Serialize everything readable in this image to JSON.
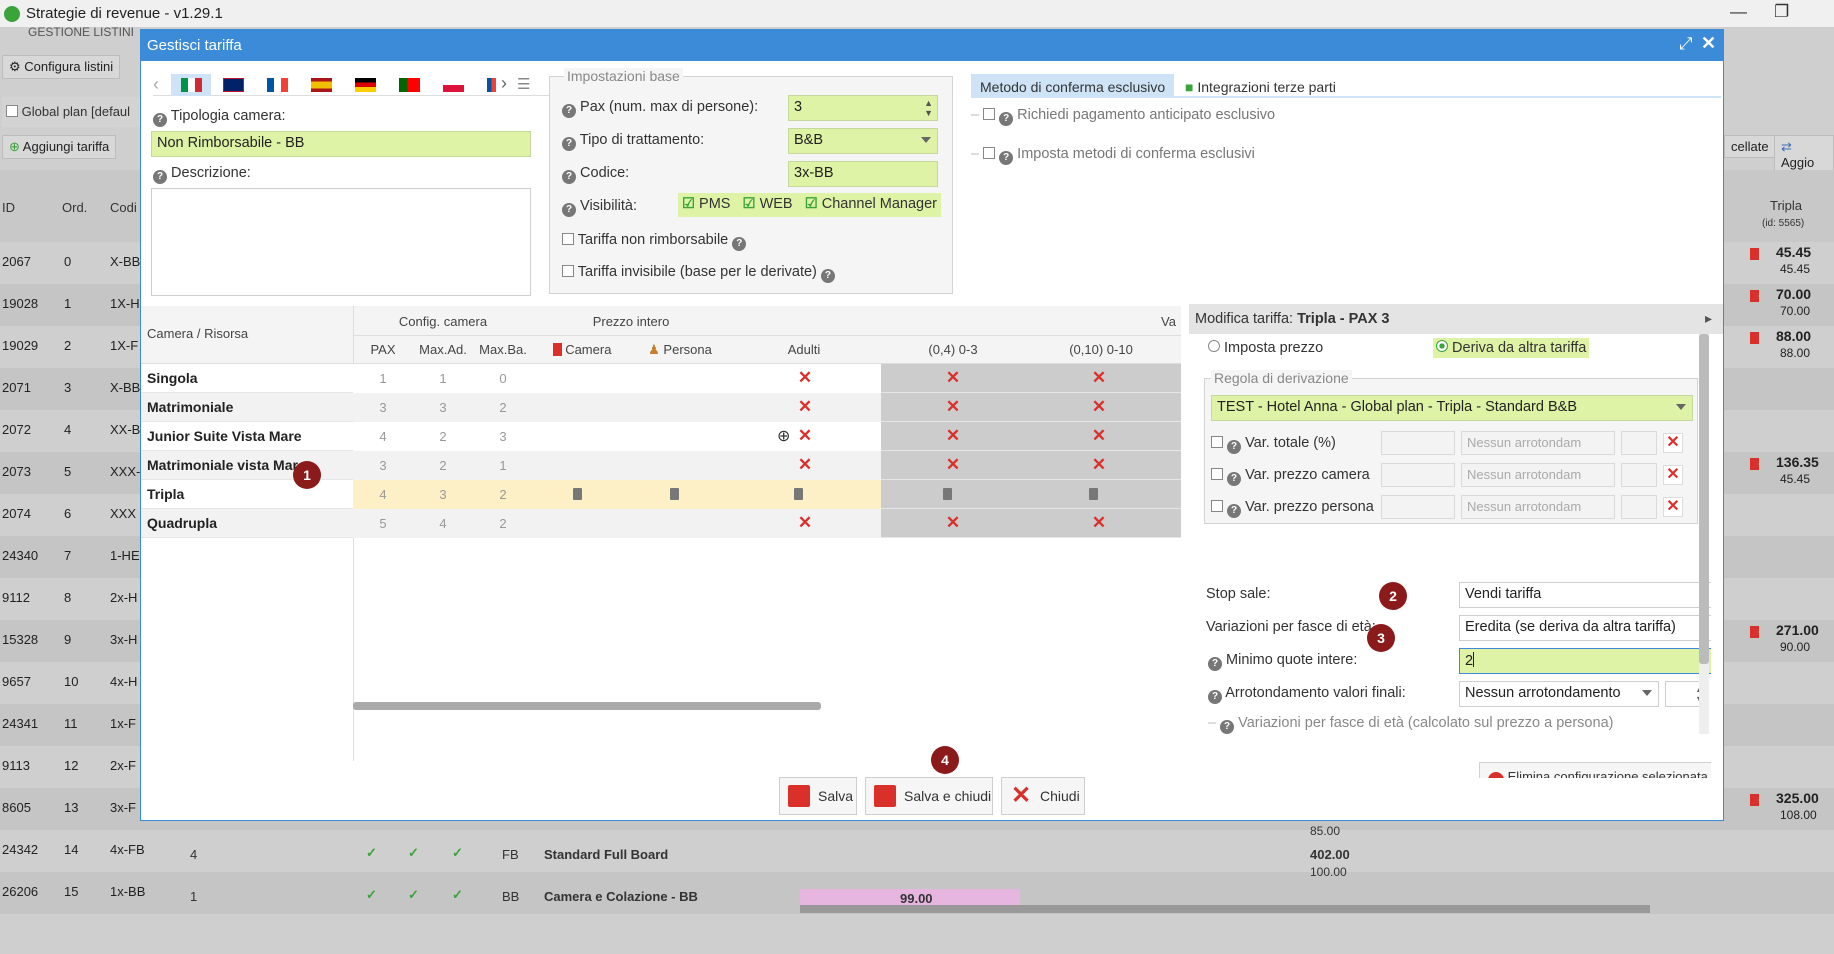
{
  "window": {
    "title": "Strategie di revenue - v1.29.1",
    "minimize": "—",
    "restore": "❐"
  },
  "background": {
    "header_crumb": "GESTIONE LISTINI",
    "configura_btn": "Configura listini",
    "global_plan": "Global plan [defaul",
    "aggiungi_btn": "Aggiungi tariffa",
    "annullate_btn": "cellate",
    "aggiorna_btn": "Aggio",
    "columns": {
      "id": "ID",
      "ord": "Ord.",
      "cod": "Codi",
      "tripla": "Tripla",
      "tripla_id": "(id: 5565)"
    },
    "rows": [
      {
        "id": "2067",
        "ord": "0",
        "cod": "X-BB",
        "p1": "45.45",
        "p2": "45.45"
      },
      {
        "id": "19028",
        "ord": "1",
        "cod": "1X-H",
        "p1": "70.00",
        "p2": "70.00"
      },
      {
        "id": "19029",
        "ord": "2",
        "cod": "1X-F",
        "p1": "88.00",
        "p2": "88.00"
      },
      {
        "id": "2071",
        "ord": "3",
        "cod": "X-BB",
        "p1": "",
        "p2": ""
      },
      {
        "id": "2072",
        "ord": "4",
        "cod": "XX-B",
        "p1": "",
        "p2": ""
      },
      {
        "id": "2073",
        "ord": "5",
        "cod": "XXX-",
        "p1": "136.35",
        "p2": "45.45"
      },
      {
        "id": "2074",
        "ord": "6",
        "cod": "XXX",
        "p1": "",
        "p2": ""
      },
      {
        "id": "24340",
        "ord": "7",
        "cod": "1-HE",
        "p1": "",
        "p2": ""
      },
      {
        "id": "9112",
        "ord": "8",
        "cod": "2x-H",
        "p1": "",
        "p2": ""
      },
      {
        "id": "15328",
        "ord": "9",
        "cod": "3x-H",
        "p1": "271.00",
        "p2": "90.00"
      },
      {
        "id": "9657",
        "ord": "10",
        "cod": "4x-H",
        "p1": "",
        "p2": ""
      },
      {
        "id": "24341",
        "ord": "11",
        "cod": "1x-F",
        "p1": "",
        "p2": ""
      },
      {
        "id": "9113",
        "ord": "12",
        "cod": "2x-F",
        "p1": "",
        "p2": ""
      },
      {
        "id": "8605",
        "ord": "13",
        "cod": "3x-F",
        "p1": "325.00",
        "p2": "108.00"
      },
      {
        "id": "24342",
        "ord": "14",
        "cod": "4x-FB",
        "p1": "",
        "p2": ""
      },
      {
        "id": "26206",
        "ord": "15",
        "cod": "1x-BB",
        "p1": "",
        "p2": ""
      }
    ],
    "row14": {
      "pax": "4",
      "treat": "FB",
      "name": "Standard Full Board",
      "v1": "85.00",
      "v2": "402.00",
      "v3": "100.00"
    },
    "row15": {
      "pax": "1",
      "treat": "BB",
      "name": "Camera e Colazione - BB",
      "v1": "99.00"
    }
  },
  "dialog": {
    "title": "Gestisci tariffa",
    "tipologia_label": "Tipologia camera:",
    "tipologia_value": "Non Rimborsabile - BB",
    "descrizione_label": "Descrizione:",
    "impostazioni_legend": "Impostazioni base",
    "pax_label": "Pax (num. max di persone):",
    "pax_value": "3",
    "trattamento_label": "Tipo di trattamento:",
    "trattamento_value": "B&B",
    "codice_label": "Codice:",
    "codice_value": "3x-BB",
    "visibilita_label": "Visibilità:",
    "vis_pms": "PMS",
    "vis_web": "WEB",
    "vis_cm": "Channel Manager",
    "non_rimborsabile": "Tariffa non rimborsabile",
    "invisibile": "Tariffa invisibile (base per le derivate)",
    "tab_metodo": "Metodo di conferma esclusivo",
    "tab_integrazioni": "Integrazioni terze parti",
    "richiedi": "Richiedi pagamento anticipato esclusivo",
    "imposta_metodi": "Imposta metodi di conferma esclusivi",
    "grid": {
      "col_camera_risorsa": "Camera / Risorsa",
      "grp_config": "Config. camera",
      "grp_prezzo": "Prezzo intero",
      "grp_va": "Va",
      "h_pax": "PAX",
      "h_maxad": "Max.Ad.",
      "h_maxba": "Max.Ba.",
      "h_camera": "Camera",
      "h_persona": "Persona",
      "h_adulti": "Adulti",
      "h_age1": "(0,4) 0-3",
      "h_age2": "(0,10) 0-10",
      "rows": [
        {
          "name": "Singola",
          "pax": "1",
          "ad": "1",
          "ba": "0"
        },
        {
          "name": "Matrimoniale",
          "pax": "3",
          "ad": "3",
          "ba": "2"
        },
        {
          "name": "Junior Suite Vista Mare",
          "pax": "4",
          "ad": "2",
          "ba": "3"
        },
        {
          "name": "Matrimoniale vista Mare",
          "pax": "3",
          "ad": "2",
          "ba": "1"
        },
        {
          "name": "Tripla",
          "pax": "4",
          "ad": "3",
          "ba": "2"
        },
        {
          "name": "Quadrupla",
          "pax": "5",
          "ad": "4",
          "ba": "2"
        }
      ]
    },
    "modifica": {
      "prefix": "Modifica tariffa:",
      "title": "Tripla - PAX 3",
      "imposta_prezzo": "Imposta prezzo",
      "deriva": "Deriva da altra tariffa",
      "regola_legend": "Regola di derivazione",
      "regola_value": "TEST - Hotel Anna - Global plan - Tripla - Standard B&B",
      "var_totale": "Var. totale (%)",
      "var_camera": "Var. prezzo camera",
      "var_persona": "Var. prezzo persona",
      "nessun_arr": "Nessun arrotondam",
      "stop_sale_label": "Stop sale:",
      "stop_sale_value": "Vendi tariffa",
      "variazioni_label": "Variazioni per fasce di età:",
      "variazioni_value": "Eredita (se deriva da altra tariffa)",
      "minimo_label": "Minimo quote intere:",
      "minimo_value": "2",
      "arrot_label": "Arrotondamento valori finali:",
      "arrot_value": "Nessun arrotondamento",
      "variazioni_section": "Variazioni per fasce di età (calcolato sul prezzo a persona)",
      "elimina": "Elimina configurazione selezionata"
    },
    "buttons": {
      "salva": "Salva",
      "salva_chiudi": "Salva e chiudi",
      "chiudi": "Chiudi"
    },
    "badges": [
      "1",
      "2",
      "3",
      "4"
    ]
  },
  "colors": {
    "accent": "#3b8bd9",
    "highlight": "#dff3a6",
    "badge": "#8b1a1a",
    "error": "#d9302a"
  }
}
